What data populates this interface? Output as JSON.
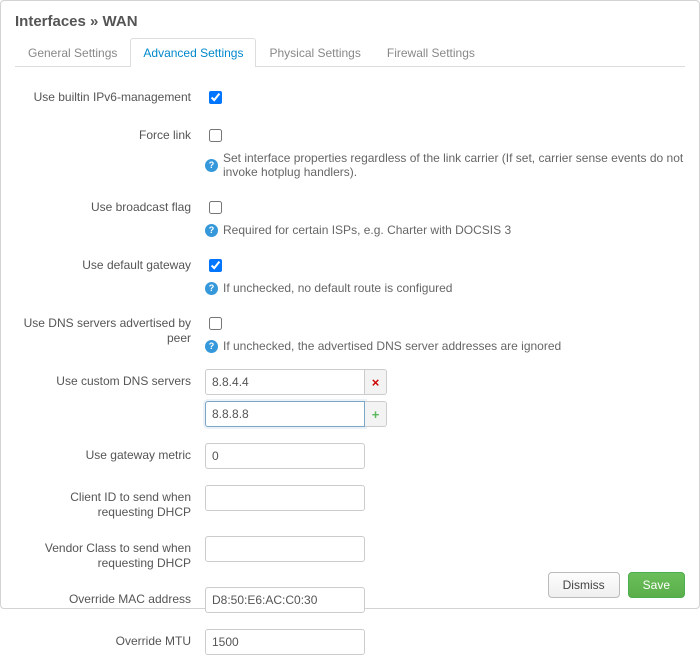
{
  "page_title": "Interfaces » WAN",
  "tabs": {
    "general": "General Settings",
    "advanced": "Advanced Settings",
    "physical": "Physical Settings",
    "firewall": "Firewall Settings"
  },
  "labels": {
    "ipv6_mgmt": "Use builtin IPv6-management",
    "force_link": "Force link",
    "force_link_help": "Set interface properties regardless of the link carrier (If set, carrier sense events do not invoke hotplug handlers).",
    "broadcast_flag": "Use broadcast flag",
    "broadcast_flag_help": "Required for certain ISPs, e.g. Charter with DOCSIS 3",
    "default_gw": "Use default gateway",
    "default_gw_help": "If unchecked, no default route is configured",
    "dns_peer": "Use DNS servers advertised by peer",
    "dns_peer_help": "If unchecked, the advertised DNS server addresses are ignored",
    "custom_dns": "Use custom DNS servers",
    "gw_metric": "Use gateway metric",
    "client_id": "Client ID to send when requesting DHCP",
    "vendor_class": "Vendor Class to send when requesting DHCP",
    "mac": "Override MAC address",
    "mtu": "Override MTU"
  },
  "values": {
    "ipv6_mgmt": true,
    "force_link": false,
    "broadcast_flag": false,
    "default_gw": true,
    "dns_peer": false,
    "dns": [
      "8.8.4.4",
      "8.8.8.8"
    ],
    "gw_metric": "0",
    "client_id": "",
    "vendor_class": "",
    "mac": "D8:50:E6:AC:C0:30",
    "mtu": "1500"
  },
  "buttons": {
    "dismiss": "Dismiss",
    "save": "Save"
  }
}
